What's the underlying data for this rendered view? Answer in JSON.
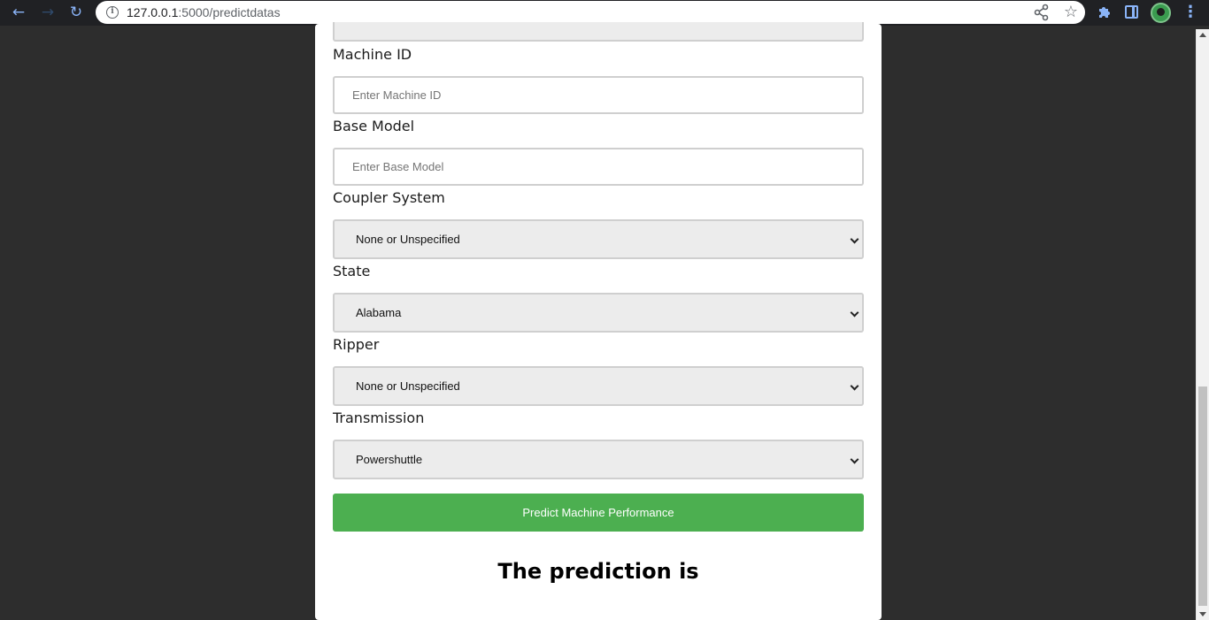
{
  "browser": {
    "url_host": "127.0.0.1",
    "url_rest": ":5000/predictdatas",
    "icons": [
      "back-icon",
      "forward-icon",
      "reload-icon",
      "info-icon",
      "share-icon",
      "star-icon",
      "extensions-icon",
      "side-panel-icon",
      "avatar",
      "menu-icon"
    ]
  },
  "form": {
    "machine_id": {
      "label": "Machine ID",
      "placeholder": "Enter Machine ID",
      "value": ""
    },
    "base_model": {
      "label": "Base Model",
      "placeholder": "Enter Base Model",
      "value": ""
    },
    "coupler_system": {
      "label": "Coupler System",
      "selected": "None or Unspecified"
    },
    "state": {
      "label": "State",
      "selected": "Alabama"
    },
    "ripper": {
      "label": "Ripper",
      "selected": "None or Unspecified"
    },
    "transmission": {
      "label": "Transmission",
      "selected": "Powershuttle"
    },
    "submit_label": "Predict Machine Performance"
  },
  "result": {
    "heading": "The prediction is"
  },
  "colors": {
    "button": "#4caf50",
    "page_bg": "#2d2d2d",
    "card_bg": "#ffffff",
    "toolbar_bg": "#202124"
  }
}
